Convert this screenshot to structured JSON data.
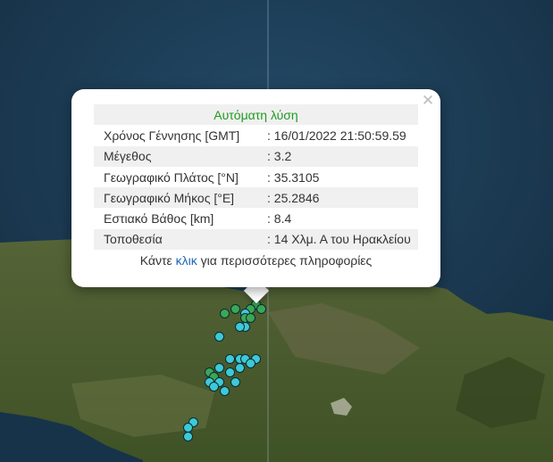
{
  "map": {
    "colors": {
      "sea": "#1b3a52",
      "land": "#4a5a2c",
      "marker_blue": "#3ec9d6",
      "marker_green": "#3aa855"
    },
    "markers": [
      {
        "lon": 25.28,
        "lat": 35.3,
        "color": "green"
      },
      {
        "lon": 25.27,
        "lat": 35.29,
        "color": "green"
      },
      {
        "lon": 25.29,
        "lat": 35.29,
        "color": "green"
      },
      {
        "lon": 25.26,
        "lat": 35.28,
        "color": "blue"
      },
      {
        "lon": 25.26,
        "lat": 35.27,
        "color": "green"
      },
      {
        "lon": 25.27,
        "lat": 35.27,
        "color": "green"
      },
      {
        "lon": 25.24,
        "lat": 35.29,
        "color": "green"
      },
      {
        "lon": 25.22,
        "lat": 35.28,
        "color": "green"
      },
      {
        "lon": 25.26,
        "lat": 35.25,
        "color": "blue"
      },
      {
        "lon": 25.25,
        "lat": 35.25,
        "color": "blue"
      },
      {
        "lon": 25.21,
        "lat": 35.23,
        "color": "blue"
      },
      {
        "lon": 25.23,
        "lat": 35.18,
        "color": "blue"
      },
      {
        "lon": 25.25,
        "lat": 35.18,
        "color": "blue"
      },
      {
        "lon": 25.26,
        "lat": 35.18,
        "color": "blue"
      },
      {
        "lon": 25.28,
        "lat": 35.18,
        "color": "blue"
      },
      {
        "lon": 25.21,
        "lat": 35.16,
        "color": "blue"
      },
      {
        "lon": 25.25,
        "lat": 35.16,
        "color": "blue"
      },
      {
        "lon": 25.27,
        "lat": 35.17,
        "color": "blue"
      },
      {
        "lon": 25.23,
        "lat": 35.15,
        "color": "blue"
      },
      {
        "lon": 25.19,
        "lat": 35.15,
        "color": "green"
      },
      {
        "lon": 25.2,
        "lat": 35.14,
        "color": "green"
      },
      {
        "lon": 25.19,
        "lat": 35.13,
        "color": "blue"
      },
      {
        "lon": 25.21,
        "lat": 35.13,
        "color": "blue"
      },
      {
        "lon": 25.2,
        "lat": 35.12,
        "color": "blue"
      },
      {
        "lon": 25.22,
        "lat": 35.11,
        "color": "blue"
      },
      {
        "lon": 25.24,
        "lat": 35.13,
        "color": "blue"
      },
      {
        "lon": 25.16,
        "lat": 35.04,
        "color": "blue"
      },
      {
        "lon": 25.15,
        "lat": 35.03,
        "color": "blue"
      },
      {
        "lon": 25.15,
        "lat": 35.01,
        "color": "blue"
      }
    ]
  },
  "popup": {
    "header": "Αυτόματη λύση",
    "rows": [
      {
        "label": "Χρόνος Γέννησης [GMT]",
        "value": ": 16/01/2022 21:50:59.59"
      },
      {
        "label": "Μέγεθος",
        "value": ": 3.2"
      },
      {
        "label": "Γεωγραφικό Πλάτος [°N]",
        "value": ": 35.3105"
      },
      {
        "label": "Γεωγραφικό Μήκος [°E]",
        "value": ": 25.2846"
      },
      {
        "label": "Εστιακό Βάθος [km]",
        "value": ": 8.4"
      },
      {
        "label": "Τοποθεσία",
        "value": ": 14 Χλμ. Α του Ηρακλείου"
      }
    ],
    "footer_prefix": "Κάντε ",
    "footer_link": "κλικ",
    "footer_suffix": " για περισσότερες πληροφορίες",
    "close_icon": "close-icon"
  }
}
